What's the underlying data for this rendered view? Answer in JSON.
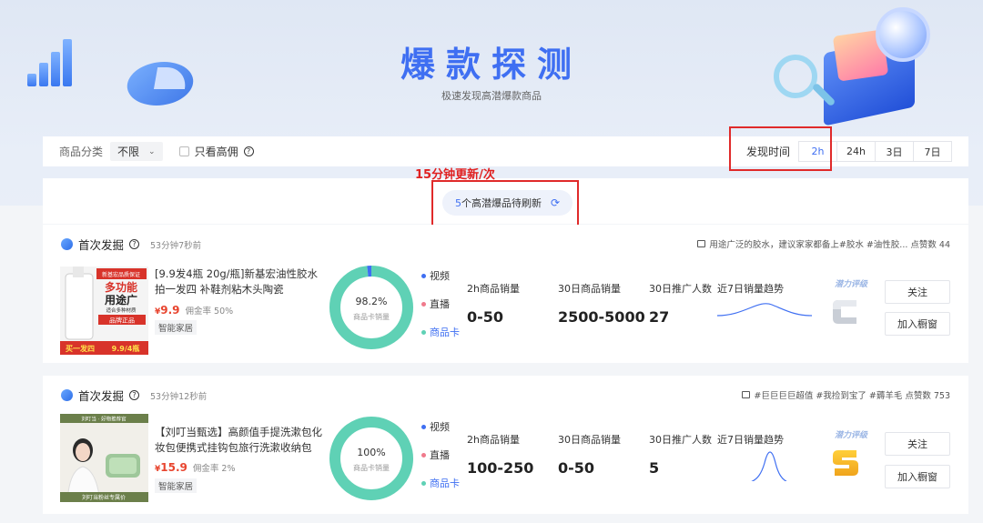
{
  "hero": {
    "title": "爆款探测",
    "subtitle": "极速发现高潜爆款商品"
  },
  "filters": {
    "category_label": "商品分类",
    "category_value": "不限",
    "high_commission_label": "只看高佣",
    "time_label": "发现时间",
    "time_options": [
      "2h",
      "24h",
      "3日",
      "7日"
    ],
    "time_selected": "2h"
  },
  "refresh": {
    "annotation": "15分钟更新/次",
    "count": "5",
    "text": "个高潜爆品待刷新"
  },
  "cards": [
    {
      "head_title": "首次发掘",
      "ago": "53分钟7秒前",
      "tags": "用途广泛的胶水，建议家家都备上#胶水 #油性胶... 点赞数 44",
      "product_title": "[9.9发4瓶 20g/瓶]新基宏油性胶水 拍一发四 补鞋剂粘木头陶瓷",
      "price_symbol": "¥",
      "price": "9.9",
      "commission": "佣金率 50%",
      "category": "智能家居",
      "donut_pct": "98.2%",
      "donut_value": 0.982,
      "donut_label": "商品卡销量",
      "legend": [
        "视频",
        "直播",
        "商品卡"
      ],
      "stat1_label": "2h商品销量",
      "stat1_value": "0-50",
      "stat2_label": "30日商品销量",
      "stat2_value": "2500-5000",
      "stat3_label": "30日推广人数",
      "stat3_value": "27",
      "trend_label": "近7日销量趋势",
      "grade_label": "潜力评级",
      "grade_letter": "C",
      "follow_label": "关注",
      "window_label": "加入橱窗",
      "thumb": {
        "top_banner": "新基宏品质保证",
        "line1": "多功能",
        "line2": "用途广",
        "line3": "适合多种材质",
        "badge": "品牌正品",
        "promo": "买一发四",
        "promo_price": "9.9/4瓶"
      }
    },
    {
      "head_title": "首次发掘",
      "ago": "53分钟12秒前",
      "tags": "#巨巨巨巨超值 #我捡到宝了 #薅羊毛 点赞数 753",
      "product_title": "【刘叮当甄选】高颜值手提洗漱包化妆包便携式挂钩包旅行洗漱收纳包",
      "price_symbol": "¥",
      "price": "15.9",
      "commission": "佣金率 2%",
      "category": "智能家居",
      "donut_pct": "100%",
      "donut_value": 1.0,
      "donut_label": "商品卡销量",
      "legend": [
        "视频",
        "直播",
        "商品卡"
      ],
      "stat1_label": "2h商品销量",
      "stat1_value": "100-250",
      "stat2_label": "30日商品销量",
      "stat2_value": "0-50",
      "stat3_label": "30日推广人数",
      "stat3_value": "5",
      "trend_label": "近7日销量趋势",
      "grade_label": "潜力评级",
      "grade_letter": "S",
      "follow_label": "关注",
      "window_label": "加入橱窗",
      "thumb": {
        "top_banner": "刘叮当 · 好物推荐官",
        "caption": "刘叮当粉丝专属价"
      }
    }
  ],
  "colors": {
    "accent": "#3f6ff2",
    "donut": "#5fd1b5",
    "legend_video": "#3f6ff2",
    "legend_live": "#f07a8c",
    "legend_card": "#5fd1b5",
    "annotation_red": "#e02a2a",
    "price_red": "#e8452f"
  }
}
